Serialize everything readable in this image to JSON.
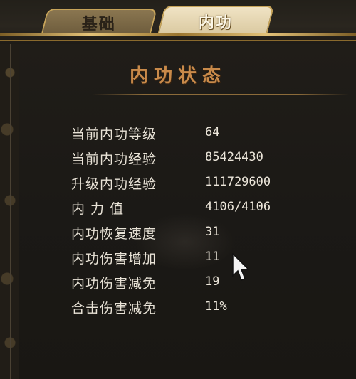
{
  "tabs": [
    {
      "label": "基础",
      "active": false
    },
    {
      "label": "内功",
      "active": true
    }
  ],
  "panel": {
    "title": "内功状态"
  },
  "stats": [
    {
      "label": "当前内功等级",
      "value": "64"
    },
    {
      "label": "当前内功经验",
      "value": "85424430"
    },
    {
      "label": "升级内功经验",
      "value": "111729600"
    },
    {
      "label": "内 力 值",
      "value": "4106/4106"
    },
    {
      "label": "内功恢复速度",
      "value": "31"
    },
    {
      "label": "内功伤害增加",
      "value": "11"
    },
    {
      "label": "内功伤害减免",
      "value": "19"
    },
    {
      "label": "合击伤害减免",
      "value": "11%"
    }
  ],
  "icons": {
    "cursor": "mouse-pointer-icon"
  },
  "colors": {
    "title": "#c98a4a",
    "gold_trim": "#c7a45a",
    "text": "#e8e2d6",
    "background": "#1c1914"
  }
}
